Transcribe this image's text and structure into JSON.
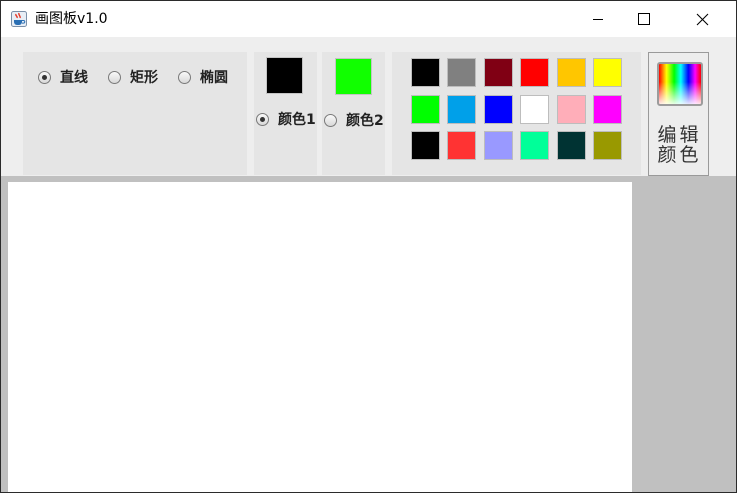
{
  "window": {
    "title": "画图板v1.0",
    "app_icon": "java-coffee-icon",
    "controls": {
      "minimize": "minimize-icon",
      "maximize": "maximize-icon",
      "close": "close-icon"
    }
  },
  "shape_options": [
    {
      "label": "直线",
      "checked": true
    },
    {
      "label": "矩形",
      "checked": false
    },
    {
      "label": "椭圆",
      "checked": false
    }
  ],
  "color1": {
    "label": "颜色1",
    "value": "#000000",
    "checked": true
  },
  "color2": {
    "label": "颜色2",
    "value": "#11ff00",
    "checked": false
  },
  "palette": [
    "#000000",
    "#808080",
    "#800014",
    "#ff0000",
    "#ffc600",
    "#ffff00",
    "#00ff00",
    "#00a0e9",
    "#0000ff",
    "#ffffff",
    "#ffaeb9",
    "#ff00ff",
    "#000000",
    "#ff3333",
    "#9999ff",
    "#00ff99",
    "#003333",
    "#999900"
  ],
  "edit_color": {
    "line1": "编辑",
    "line2": "颜色",
    "icon": "rainbow-spectrum-icon"
  }
}
